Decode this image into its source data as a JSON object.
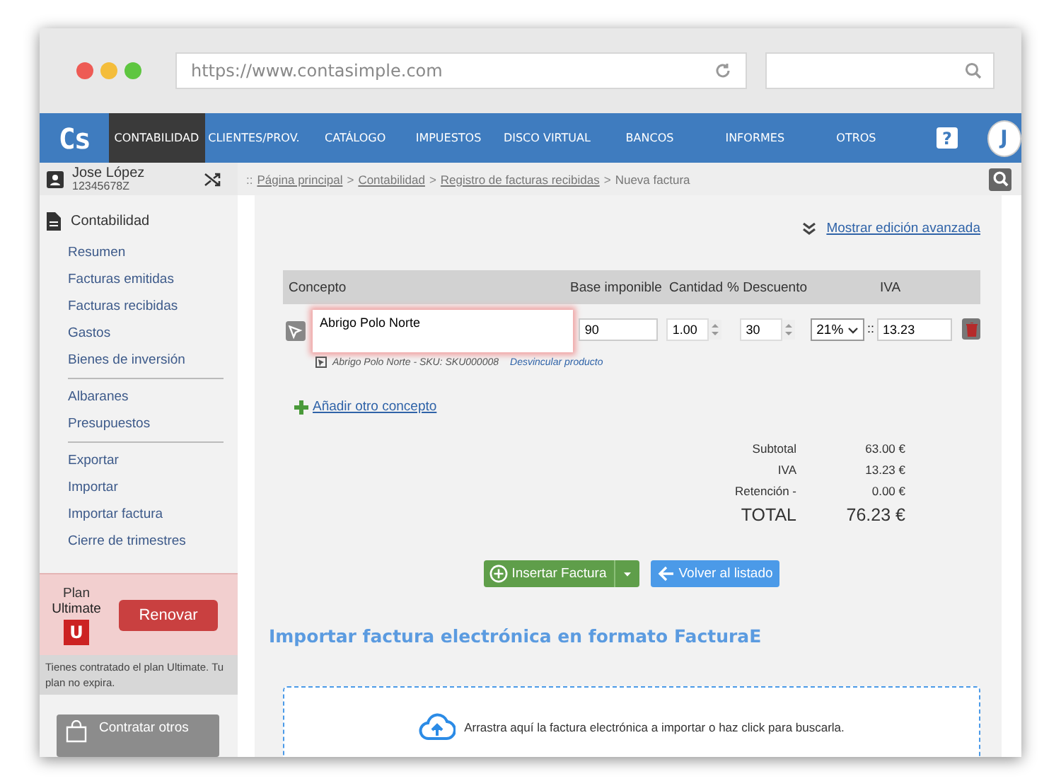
{
  "browser": {
    "url": "https://www.contasimple.com"
  },
  "nav": {
    "logo": "Cs",
    "help": "?",
    "avatar": "J",
    "tabs": [
      {
        "label": "CONTABILIDAD",
        "selected": true
      },
      {
        "label": "CLIENTES/PROV.",
        "selected": false
      },
      {
        "label": "CATÁLOGO",
        "selected": false
      },
      {
        "label": "IMPUESTOS",
        "selected": false
      },
      {
        "label": "DISCO VIRTUAL",
        "selected": false
      },
      {
        "label": "BANCOS",
        "selected": false
      },
      {
        "label": "INFORMES",
        "selected": false
      },
      {
        "label": "OTROS",
        "selected": false
      }
    ]
  },
  "user": {
    "name": "Jose López",
    "id": "12345678Z"
  },
  "sidebar": {
    "section": "Contabilidad",
    "groups": [
      [
        "Resumen",
        "Facturas emitidas",
        "Facturas recibidas",
        "Gastos",
        "Bienes de inversión"
      ],
      [
        "Albaranes",
        "Presupuestos"
      ],
      [
        "Exportar",
        "Importar",
        "Importar factura",
        "Cierre de trimestres"
      ]
    ]
  },
  "plan": {
    "label": "Plan",
    "name": "Ultimate",
    "badge": "U",
    "button": "Renovar",
    "note": "Tienes contratado el plan Ultimate. Tu plan no expira.",
    "more_button": "Contratar otros"
  },
  "breadcrumb": {
    "prefix": "::",
    "separator": ">",
    "items": [
      {
        "label": "Página principal",
        "link": true
      },
      {
        "label": "Contabilidad",
        "link": true
      },
      {
        "label": "Registro de facturas recibidas",
        "link": true
      },
      {
        "label": "Nueva factura",
        "link": false
      }
    ]
  },
  "advanced_link": "Mostrar edición avanzada",
  "table": {
    "columns": [
      "Concepto",
      "Base imponible",
      "Cantidad",
      "% Descuento",
      "IVA"
    ],
    "rows": [
      {
        "concept": "Abrigo Polo Norte",
        "error": true,
        "base": "90",
        "quantity": "1.00",
        "discount": "30",
        "vat_rate": "21%",
        "separator": "::",
        "vat": "13.23",
        "product": "Abrigo Polo Norte - SKU: SKU000008",
        "unlink": "Desvincular producto"
      }
    ]
  },
  "add_line": "Añadir otro concepto",
  "totals": [
    {
      "label": "Subtotal",
      "value": "63.00 €",
      "kind": "line"
    },
    {
      "label": "IVA",
      "value": "13.23 €",
      "kind": "line"
    },
    {
      "label": "Retención -",
      "value": "0.00 €",
      "kind": "line"
    },
    {
      "label": "TOTAL",
      "value": "76.23 €",
      "kind": "total"
    }
  ],
  "buttons": {
    "insert": "Insertar Factura",
    "back": "Volver al listado"
  },
  "import": {
    "title": "Importar factura electrónica en formato FacturaE",
    "dropzone": "Arrastra aquí la factura electrónica a importar o haz click para buscarla."
  }
}
